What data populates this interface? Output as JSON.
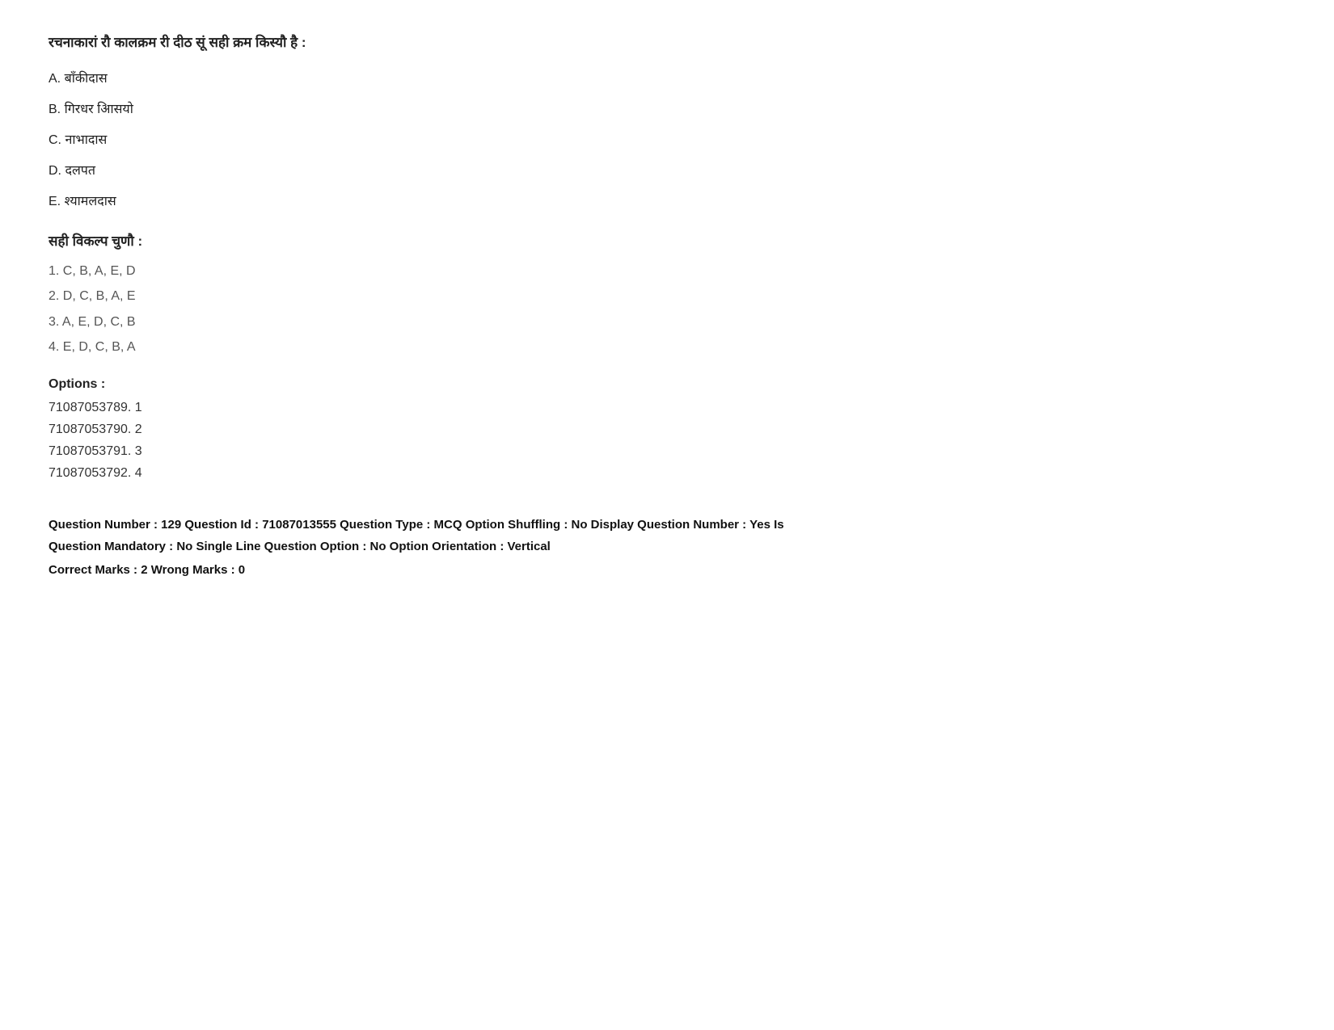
{
  "question": {
    "text": "रचनाकारां रौ कालक्रम री दीठ सूं सही क्रम किस्यौ है :",
    "options": [
      {
        "label": "A.",
        "text": "बाँकीदास"
      },
      {
        "label": "B.",
        "text": "गिरधर आिसयो"
      },
      {
        "label": "C.",
        "text": "नाभादास"
      },
      {
        "label": "D.",
        "text": "दलपत"
      },
      {
        "label": "E.",
        "text": "श्यामलदास"
      }
    ],
    "correct_options_label": "सही विकल्प चुणौ :",
    "answer_options": [
      "1. C, B, A, E, D",
      "2. D, C, B, A, E",
      "3. A, E, D, C, B",
      "4. E, D, C, B, A"
    ],
    "options_label": "Options :",
    "option_codes": [
      "71087053789. 1",
      "71087053790. 2",
      "71087053791. 3",
      "71087053792. 4"
    ],
    "meta": {
      "line1": "Question Number : 129 Question Id : 71087013555 Question Type : MCQ Option Shuffling : No Display Question Number : Yes Is",
      "line2": "Question Mandatory : No Single Line Question Option : No Option Orientation : Vertical",
      "line3": "Correct Marks : 2 Wrong Marks : 0"
    }
  }
}
